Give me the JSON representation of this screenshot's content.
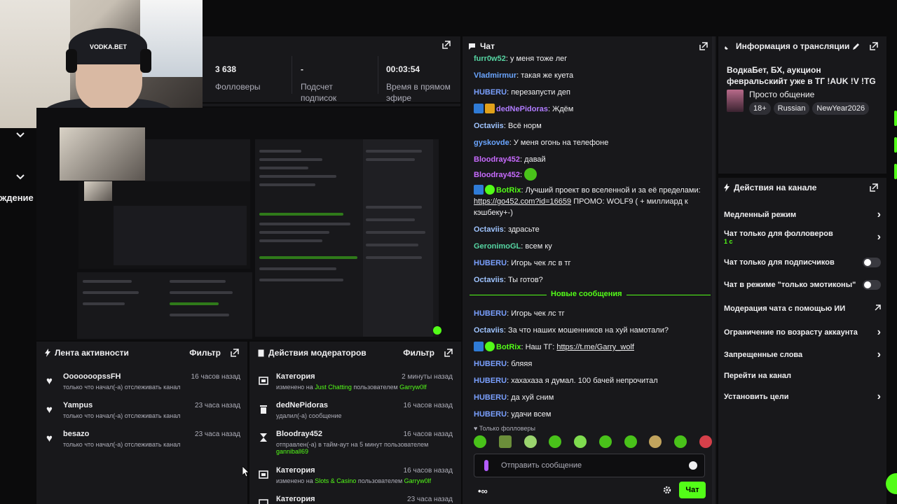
{
  "stats": [
    {
      "value": "3 638",
      "label": "Фолловеры"
    },
    {
      "value": "-",
      "label": "Подсчет подписок"
    },
    {
      "value": "00:03:54",
      "label": "Время в прямом эфире"
    }
  ],
  "left_stub": {
    "label": "ждение"
  },
  "chat": {
    "title": "Чат",
    "messages": [
      {
        "nick": "furr0w52",
        "color": "#56d6a3",
        "text": "у меня тоже лег"
      },
      {
        "nick": "Vladmirmur",
        "color": "#6aa5ff",
        "text": "такая же куета"
      },
      {
        "nick": "HUBERU",
        "color": "#7aa0ff",
        "text": "перезапусти деп"
      },
      {
        "nick": "dedNePidoras",
        "color": "#b17cff",
        "text": "Ждём"
      },
      {
        "nick": "Octaviis",
        "color": "#9fc4ff",
        "text": "Всё норм"
      },
      {
        "nick": "gyskovde",
        "color": "#6aa5ff",
        "text": "У меня огонь на телефоне"
      },
      {
        "nick": "Bloodray452",
        "color": "#c86bff",
        "text": "давай"
      },
      {
        "nick": "Bloodray452",
        "color": "#c86bff",
        "text": ""
      },
      {
        "nick": "BotRix",
        "color": "#53fc18",
        "text": "Лучший проект во вселенной и за её пределами:",
        "link": "https://go452.com?id=16659",
        "tail": "ПРОМО: WOLF9 ( + миллиард к кэшбеку+-)"
      },
      {
        "nick": "Octaviis",
        "color": "#9fc4ff",
        "text": "здрасьте"
      },
      {
        "nick": "GeronimoGL",
        "color": "#56d6a3",
        "text": "всем ку"
      },
      {
        "nick": "HUBERU",
        "color": "#7aa0ff",
        "text": "Игорь чек лс в тг"
      },
      {
        "nick": "Octaviis",
        "color": "#9fc4ff",
        "text": "Ты готов?"
      },
      {
        "nick": "HUBERU",
        "color": "#7aa0ff",
        "text": "Игорь чек лс тг"
      },
      {
        "nick": "Octaviis",
        "color": "#9fc4ff",
        "text": "За что наших мошенников на хуй намотали?"
      },
      {
        "nick": "BotRix",
        "color": "#53fc18",
        "text": "Наш ТГ:",
        "link": "https://t.me/Garry_wolf"
      },
      {
        "nick": "HUBERU",
        "color": "#7aa0ff",
        "text": "бляяя"
      },
      {
        "nick": "HUBERU",
        "color": "#7aa0ff",
        "text": "хахахаза я думал. 100 бачей непрочитал"
      },
      {
        "nick": "HUBERU",
        "color": "#7aa0ff",
        "text": "да хуй сним"
      },
      {
        "nick": "HUBERU",
        "color": "#7aa0ff",
        "text": "удачи всем"
      }
    ],
    "new_messages_label": "Новые сообщения",
    "followers_only_label": "Только фолловеры",
    "input_placeholder": "Отправить сообщение",
    "send_label": "Чат"
  },
  "activity": {
    "title": "Лента активности",
    "filter_label": "Фильтр",
    "items": [
      {
        "name": "OoooooopssFH",
        "time": "16 часов назад",
        "desc": "только что начал(-а) отслеживать канал"
      },
      {
        "name": "Yampus",
        "time": "23 часа назад",
        "desc": "только что начал(-а) отслеживать канал"
      },
      {
        "name": "besazo",
        "time": "23 часа назад",
        "desc": "только что начал(-а) отслеживать канал"
      }
    ]
  },
  "mods": {
    "title": "Действия модераторов",
    "filter_label": "Фильтр",
    "items": [
      {
        "icon": "category-icon",
        "name": "Категория",
        "time": "2 минуты назад",
        "pre": "изменено на",
        "hl": "Just Chatting",
        "mid": "пользователем",
        "user": "Garryw0lf"
      },
      {
        "icon": "trash-icon",
        "name": "dedNePidoras",
        "time": "16 часов назад",
        "pre": "удалил(-а) сообщение",
        "hl": "",
        "mid": "",
        "user": ""
      },
      {
        "icon": "hourglass-icon",
        "name": "Bloodray452",
        "time": "16 часов назад",
        "pre": "отправлен(-а) в тайм-аут на 5 минут пользователем",
        "hl": "",
        "mid": "",
        "user": "ganniball69"
      },
      {
        "icon": "category-icon",
        "name": "Категория",
        "time": "16 часов назад",
        "pre": "изменено на",
        "hl": "Slots & Casino",
        "mid": "пользователем",
        "user": "Garryw0lf"
      },
      {
        "icon": "category-icon",
        "name": "Категория",
        "time": "23 часа назад",
        "pre": "",
        "hl": "",
        "mid": "",
        "user": ""
      }
    ]
  },
  "info": {
    "title": "Информация о трансляции",
    "stream_title": "ВодкаБет, БХ, аукцион февральскийт уже в ТГ !AUK !V !TG",
    "category": "Просто общение",
    "tags": [
      "18+",
      "Russian",
      "NewYear2026"
    ]
  },
  "actions": {
    "title": "Действия на канале",
    "items": [
      {
        "label": "Медленный режим",
        "sub": "",
        "control": "chevron"
      },
      {
        "label": "Чат только для фолловеров",
        "sub": "1 с",
        "control": "chevron"
      },
      {
        "label": "Чат только для подписчиков",
        "sub": "",
        "control": "toggle"
      },
      {
        "label": "Чат в режиме \"только эмотиконы\"",
        "sub": "",
        "control": "toggle"
      },
      {
        "label": "Модерация чата с помощью ИИ",
        "sub": "",
        "control": "external"
      },
      {
        "label": "Ограничение по возрасту аккаунта",
        "sub": "",
        "control": "chevron"
      },
      {
        "label": "Запрещенные слова",
        "sub": "",
        "control": "chevron"
      },
      {
        "label": "Перейти на канал",
        "sub": "",
        "control": "none"
      },
      {
        "label": "Установить цели",
        "sub": "",
        "control": "chevron"
      }
    ]
  },
  "webcam": {
    "cap_text": "VODKA.BET"
  },
  "colors": {
    "accent": "#53fc18",
    "panel": "#18181b",
    "bg": "#0e0e10"
  }
}
